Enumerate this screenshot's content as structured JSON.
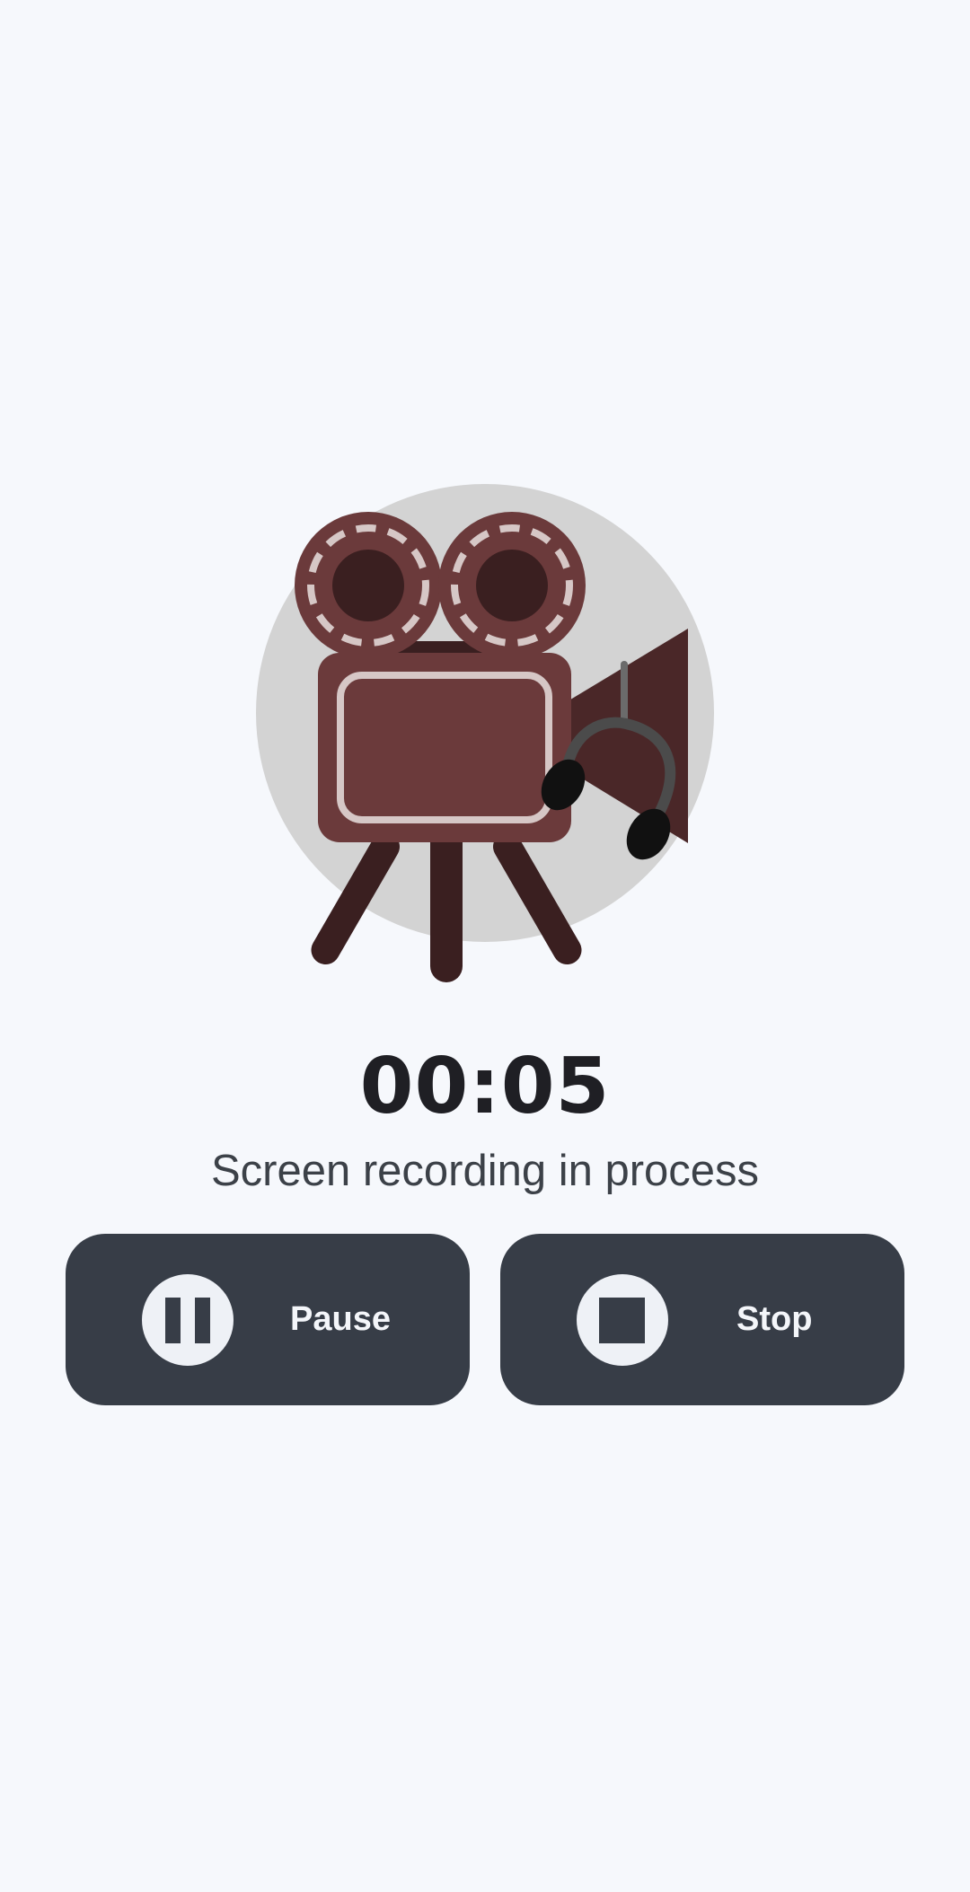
{
  "recorder": {
    "timer": "00:05",
    "status": "Screen recording in process"
  },
  "controls": {
    "pause_label": "Pause",
    "stop_label": "Stop"
  },
  "icons": {
    "illustration": "film-camera-illustration",
    "pause": "pause-icon",
    "stop": "stop-icon"
  },
  "colors": {
    "background": "#f6f8fc",
    "button": "#373d47",
    "camera_body": "#6b3a3b",
    "camera_dark": "#3a1f20"
  }
}
